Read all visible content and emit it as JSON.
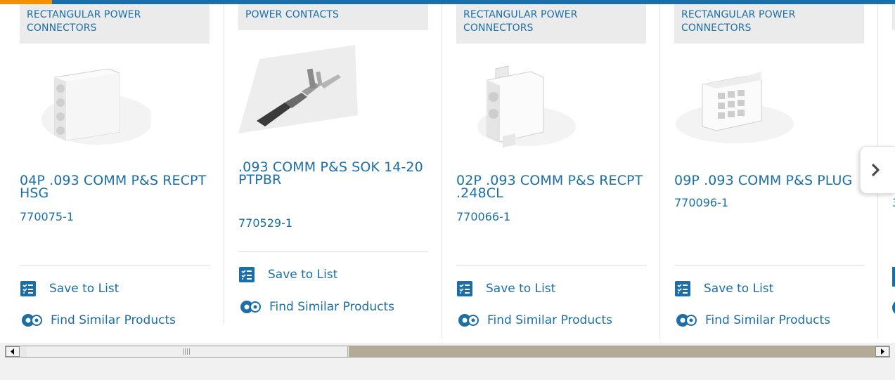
{
  "colors": {
    "accent_blue": "#1a6fa8",
    "accent_orange": "#f29100",
    "category_bg": "#ebebeb"
  },
  "cards": [
    {
      "category": "RECTANGULAR POWER CONNECTORS",
      "title": "04P .093 COMM P&S RECPT HSG",
      "part_number": "770075-1",
      "save_label": "Save to List",
      "similar_label": "Find Similar Products",
      "image_icon": "4-position-receptacle-housing"
    },
    {
      "category": "POWER CONTACTS",
      "title": ".093 COMM P&S SOK 14-20 PTPBR",
      "part_number": "770529-1",
      "save_label": "Save to List",
      "similar_label": "Find Similar Products",
      "image_icon": "crimp-socket-contact"
    },
    {
      "category": "RECTANGULAR POWER CONNECTORS",
      "title": "02P .093 COMM P&S RECPT .248CL",
      "part_number": "770066-1",
      "save_label": "Save to List",
      "similar_label": "Find Similar Products",
      "image_icon": "2-position-receptacle"
    },
    {
      "category": "RECTANGULAR POWER CONNECTORS",
      "title": "09P .093 COMM P&S PLUG",
      "part_number": "770096-1",
      "save_label": "Save to List",
      "similar_label": "Find Similar Products",
      "image_icon": "9-position-plug-housing"
    }
  ],
  "partial_card": {
    "part_prefix": "3"
  },
  "next_button": {
    "icon": "chevron-right-icon"
  },
  "scrollbar": {
    "icons": [
      "scroll-left-icon",
      "scroll-right-icon"
    ]
  }
}
